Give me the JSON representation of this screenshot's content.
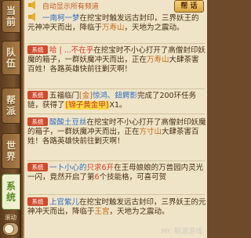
{
  "sidebar": {
    "tabs": [
      {
        "label1": "当",
        "label2": "前",
        "active": false
      },
      {
        "label1": "队",
        "label2": "伍",
        "active": false
      },
      {
        "label1": "帮",
        "label2": "派",
        "active": false
      },
      {
        "label1": "世",
        "label2": "界",
        "active": false
      },
      {
        "label1": "系",
        "label2": "统",
        "active": true
      }
    ],
    "auto_scroll_label": "滚动"
  },
  "header": {
    "partial_text": "自动显示所有频道",
    "close_label": "帮 话"
  },
  "messages": [
    {
      "parts": [
        {
          "t": "一南柯一梦",
          "c": "blue"
        },
        {
          "t": "在挖宝时触发远古封印，三界妖王的元神冲天而出，降临于"
        },
        {
          "t": "万寿山",
          "c": "orange"
        },
        {
          "t": "，天地为之震动。"
        }
      ]
    },
    {
      "badge": "系统",
      "parts": [
        {
          "t": "哈  | ...不在乎",
          "c": "red"
        },
        {
          "t": "在挖宝时不小心打开了高僧封印妖魔的箱子，一群妖魔冲天而出，正在"
        },
        {
          "t": "万寿山",
          "c": "orange"
        },
        {
          "t": "大肆茶害百姓！各路英雄快前往剿灭啊！"
        }
      ]
    },
    {
      "badge": "系统",
      "parts": [
        {
          "t": "五福临门"
        },
        {
          "t": "[金]",
          "c": "orange"
        },
        {
          "t": "惊鸿、鈕鳄影",
          "c": "blue"
        },
        {
          "t": "完成了200环任务链，获得了"
        },
        {
          "t": "[锦子黄金甲]",
          "c": "boxed"
        },
        {
          "t": "X1。"
        }
      ]
    },
    {
      "badge": "系统",
      "parts": [
        {
          "t": "酸酸土豆丝",
          "c": "blue"
        },
        {
          "t": "在挖宝时不小心打开了高僧封印妖魔的箱子，一群妖魔冲天而出，正在"
        },
        {
          "t": "方寸山",
          "c": "orange"
        },
        {
          "t": "大肆茶害百姓！各路英雄快前往剿灭啊！"
        }
      ]
    },
    {
      "badge": "系统",
      "parts": [
        {
          "t": "一卜小心的",
          "c": "blue"
        },
        {
          "t": "只求6开",
          "c": "red"
        },
        {
          "t": "在王母娘娘的万兽园内灵光一闪，竟然开启了第"
        },
        {
          "t": "6",
          "c": "red"
        },
        {
          "t": "个技能格，可喜可贺"
        }
      ]
    },
    {
      "badge": "系统",
      "parts": [
        {
          "t": "上官紫儿",
          "c": "blue"
        },
        {
          "t": "在挖宝时触发远古封印，三界妖王的元神冲天而出，降临于"
        },
        {
          "t": "王宫",
          "c": "orange"
        },
        {
          "t": "，天地为之震动。"
        }
      ]
    }
  ],
  "watermark": "Mr. 新浪游戏"
}
